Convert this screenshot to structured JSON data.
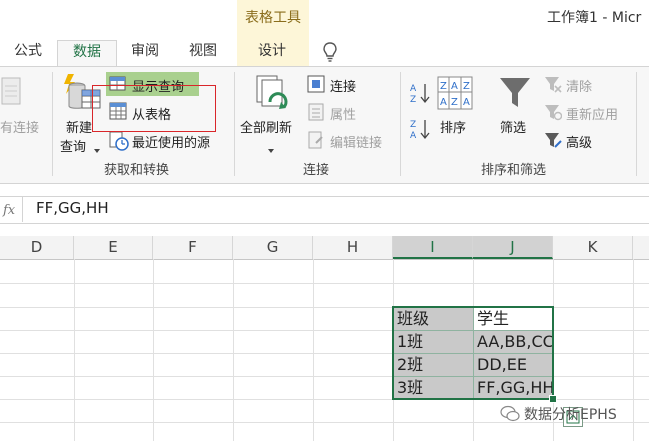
{
  "window": {
    "context_tab_group": "表格工具",
    "doc_title": "工作簿1 - Micr"
  },
  "tabs": [
    {
      "label": "公式"
    },
    {
      "label": "数据"
    },
    {
      "label": "审阅"
    },
    {
      "label": "视图"
    },
    {
      "label": "设计"
    }
  ],
  "ribbon": {
    "get_transform": {
      "existing_connections": "有连接",
      "new_query_line1": "新建",
      "new_query_line2": "查询",
      "show_queries": "显示查询",
      "from_table": "从表格",
      "recent_sources": "最近使用的源",
      "group_label": "获取和转换"
    },
    "connections": {
      "refresh_all": "全部刷新",
      "connections": "连接",
      "properties": "属性",
      "edit_links": "编辑链接",
      "group_label": "连接"
    },
    "sort_filter": {
      "sort": "排序",
      "filter": "筛选",
      "clear": "清除",
      "reapply": "重新应用",
      "advanced": "高级",
      "group_label": "排序和筛选"
    }
  },
  "formula_bar": {
    "value": "FF,GG,HH"
  },
  "grid": {
    "columns": [
      "D",
      "E",
      "F",
      "G",
      "H",
      "I",
      "J",
      "K"
    ],
    "table": [
      [
        "班级",
        "学生"
      ],
      [
        "1班",
        "AA,BB,CC"
      ],
      [
        "2班",
        "DD,EE"
      ],
      [
        "3班",
        "FF,GG,HH"
      ]
    ]
  },
  "watermark": "数据分析EPHS",
  "colors": {
    "accent": "#217346",
    "highlight_green": "#a9d08e",
    "annotation_red": "#d9262a"
  }
}
